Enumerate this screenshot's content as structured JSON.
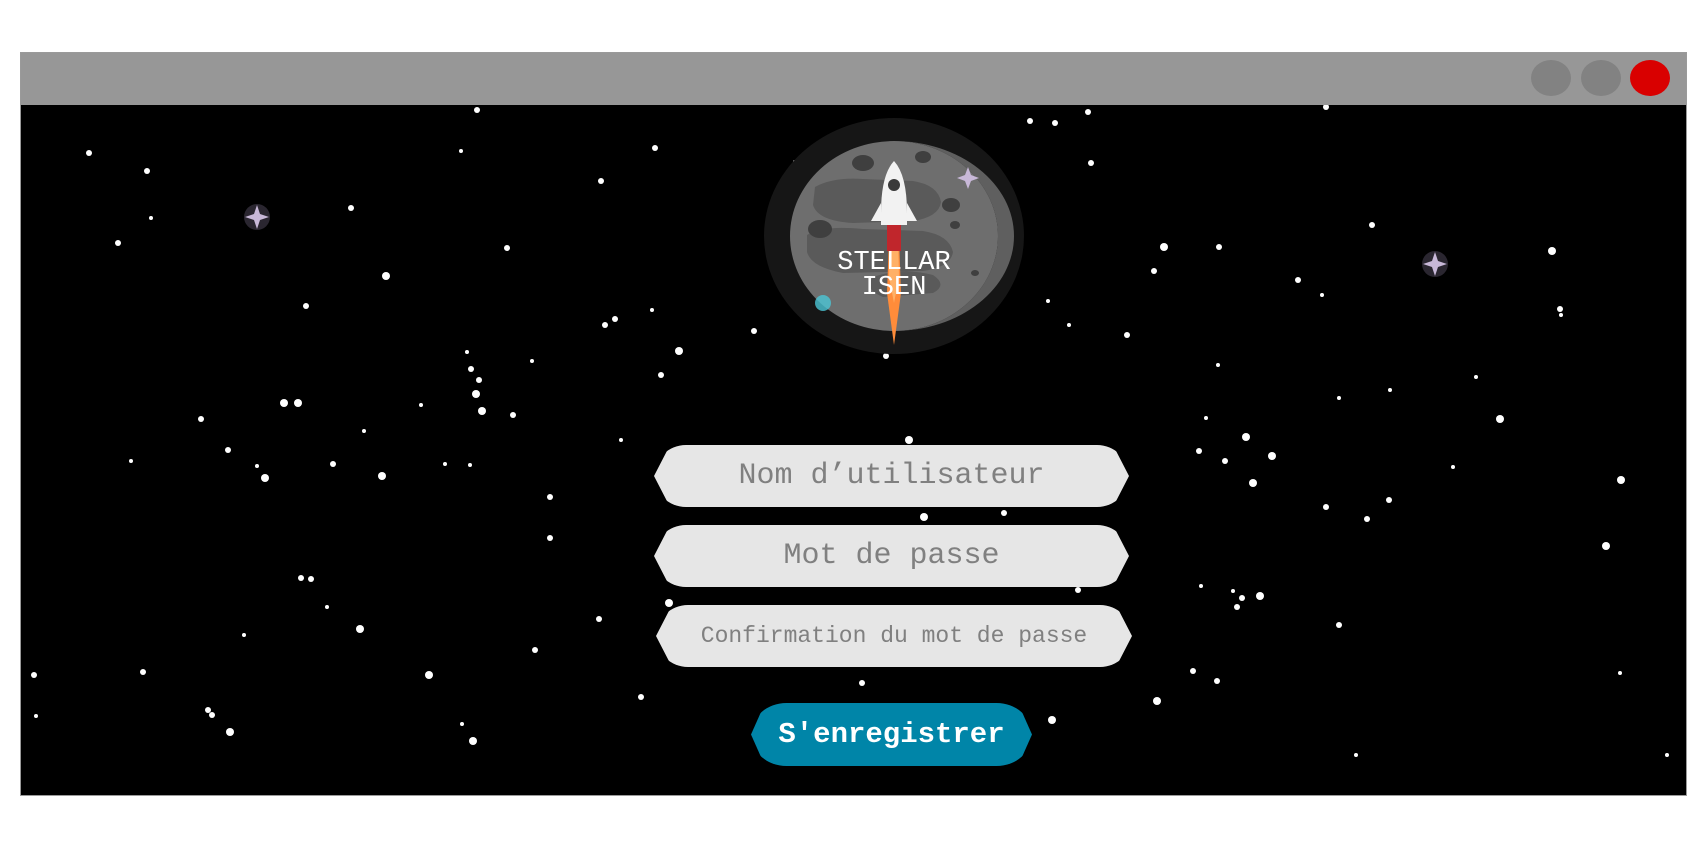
{
  "window": {
    "controls": [
      "minimize",
      "maximize",
      "close"
    ],
    "close_color": "#d90000",
    "titlebar_color": "#979797"
  },
  "logo": {
    "line1": "STELLAR",
    "line2": "ISEN",
    "icon": "rocket-moon-logo"
  },
  "form": {
    "username_placeholder": "Nom d’utilisateur",
    "password_placeholder": "Mot de passe",
    "confirm_placeholder": "Confirmation du mot de passe",
    "submit_label": "S'enregistrer",
    "submit_color": "#0085a8"
  }
}
